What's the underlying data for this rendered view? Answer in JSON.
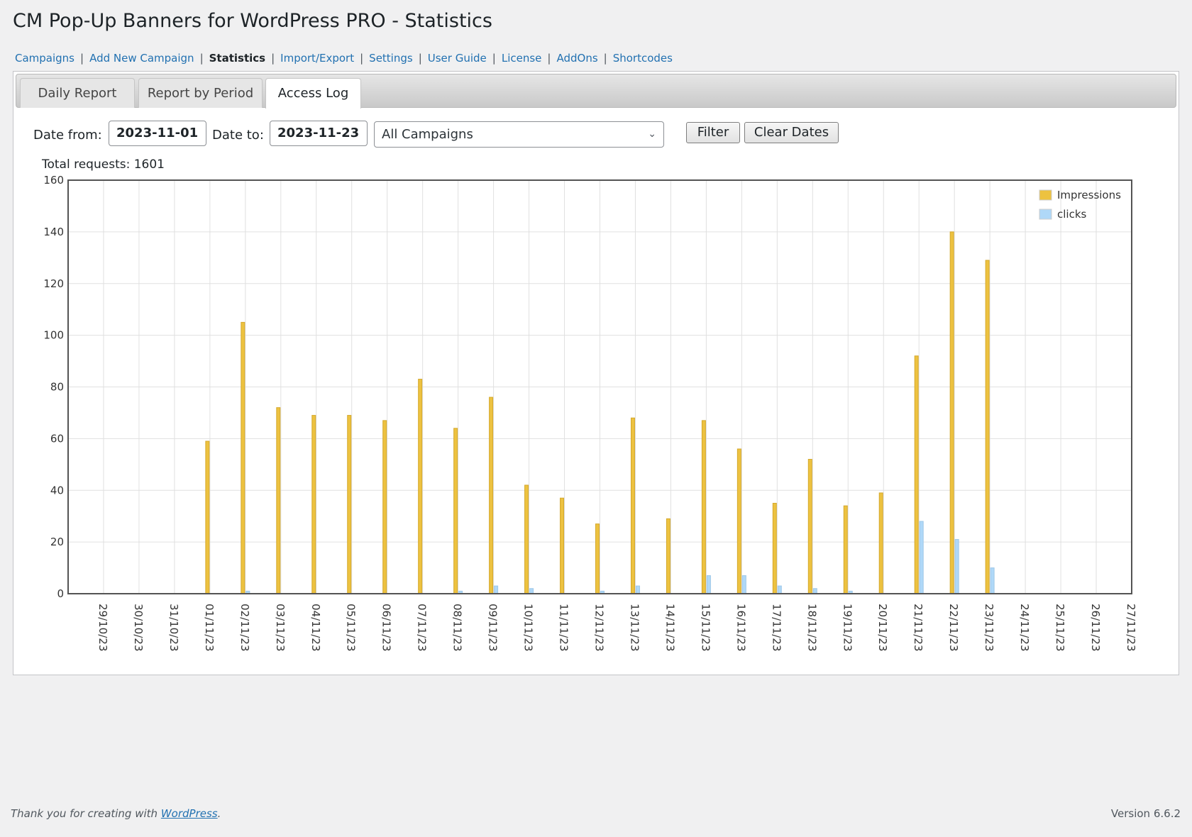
{
  "page_title": "CM Pop-Up Banners for WordPress PRO - Statistics",
  "subnav": [
    {
      "label": "Campaigns",
      "current": false
    },
    {
      "label": "Add New Campaign",
      "current": false
    },
    {
      "label": "Statistics",
      "current": true
    },
    {
      "label": "Import/Export",
      "current": false
    },
    {
      "label": "Settings",
      "current": false
    },
    {
      "label": "User Guide",
      "current": false
    },
    {
      "label": "License",
      "current": false
    },
    {
      "label": "AddOns",
      "current": false
    },
    {
      "label": "Shortcodes",
      "current": false
    }
  ],
  "tabs": [
    {
      "label": "Daily Report",
      "active": false
    },
    {
      "label": "Report by Period",
      "active": false
    },
    {
      "label": "Access Log",
      "active": true
    }
  ],
  "filters": {
    "date_from_label": "Date from:",
    "date_from_value": "2023-11-01",
    "date_to_label": "Date to:",
    "date_to_value": "2023-11-23",
    "campaign_select": "All Campaigns",
    "filter_button": "Filter",
    "clear_button": "Clear Dates"
  },
  "total": {
    "label": "Total requests:",
    "value": "1601"
  },
  "chart_data": {
    "type": "bar",
    "categories": [
      "29/10/23",
      "30/10/23",
      "31/10/23",
      "01/11/23",
      "02/11/23",
      "03/11/23",
      "04/11/23",
      "05/11/23",
      "06/11/23",
      "07/11/23",
      "08/11/23",
      "09/11/23",
      "10/11/23",
      "11/11/23",
      "12/11/23",
      "13/11/23",
      "14/11/23",
      "15/11/23",
      "16/11/23",
      "17/11/23",
      "18/11/23",
      "19/11/23",
      "20/11/23",
      "21/11/23",
      "22/11/23",
      "23/11/23",
      "24/11/23",
      "25/11/23",
      "26/11/23",
      "27/11/23"
    ],
    "series": [
      {
        "name": "Impressions",
        "color": "#edc240",
        "values": [
          0,
          0,
          0,
          59,
          105,
          72,
          69,
          69,
          67,
          83,
          64,
          76,
          42,
          37,
          27,
          68,
          29,
          67,
          56,
          35,
          52,
          34,
          39,
          92,
          140,
          129,
          0,
          0,
          0,
          0
        ]
      },
      {
        "name": "clicks",
        "color": "#afd8f8",
        "values": [
          0,
          0,
          0,
          0,
          1,
          0,
          0,
          0,
          0,
          0,
          1,
          3,
          2,
          0,
          1,
          3,
          0,
          7,
          7,
          3,
          2,
          1,
          0,
          28,
          21,
          10,
          0,
          0,
          0,
          0
        ]
      }
    ],
    "yticks": [
      0,
      20,
      40,
      60,
      80,
      100,
      120,
      140,
      160
    ],
    "ylim": [
      0,
      160
    ],
    "grid": true,
    "legend_position": "top-right"
  },
  "footer": {
    "thanks_prefix": "Thank you for creating with",
    "thanks_link": "WordPress",
    "thanks_suffix": ".",
    "version": "Version 6.6.2"
  }
}
